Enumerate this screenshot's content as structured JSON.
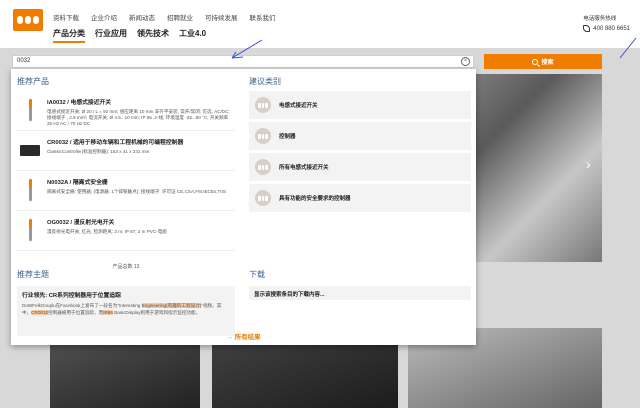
{
  "header": {
    "top_links": [
      "资料下载",
      "企业介绍",
      "新闻动态",
      "招聘就业",
      "可持续发展",
      "联系我们"
    ],
    "main_nav": [
      "产品分类",
      "行业应用",
      "领先技术",
      "工业4.0"
    ],
    "hotline_label": "电话服务热线",
    "hotline_number": "400 880 6651"
  },
  "search": {
    "query": "0032",
    "button_label": "搜索"
  },
  "panel": {
    "products_title": "推荐产品",
    "products": [
      {
        "title": "IA0032 / 电感式接近开关",
        "desc": "电感式接近开关; Ø 20 / L = 92 mm; 感应距离 10 mm 非齐平安装; 常开/常闭; 可选; AC/DC; 接线端子 , 2.5 mm²; 电流开关; Ø 4.5...10 mm; IP 65 ,2-线; 环境温度 -25...80 °C; 开关频率 25 Hz AC / 70 Hz DC",
        "thumb": "sensor"
      },
      {
        "title": "CR0032 / 适用于移动车辆和工程机械的可编程控制器",
        "desc": "ClassicController(标准控制器); 153 x 41 x 241 mm",
        "thumb": "controller"
      },
      {
        "title": "N0032A / 隔离式安全栅",
        "desc": "隔离式安全栅; 使用器; (电源器: 1个碎铁触点); 接线端子: 许可证 CE,CSA,FM,IECEx,TIIS",
        "thumb": "sensor"
      },
      {
        "title": "OG0032 / 漫反射光电开关",
        "desc": "漫反射光电开关; 红光; 检测距离: 3 m; IP 67; 2 m PVC-电缆",
        "thumb": "sensor"
      }
    ],
    "product_count": "产品总数 13",
    "suggest_title": "建议类别",
    "suggestions": [
      "电感式接近开关",
      "控制器",
      "所有电感式接近开关",
      "具有功能的安全要求的控制器"
    ],
    "topics_title": "推荐主题",
    "topic": {
      "title": "行业领先: CR系列控制器用于位置追踪",
      "desc_1": "DoWFelkGnuplu在Facebook上发布了一段名为\"Interesting ",
      "desc_hl_1": "Engineering(有趣的工程设计)",
      "desc_2": "\"视频。其中，",
      "desc_hl_2": "CR0032",
      "desc_3": "控制器被用于位置追踪，而",
      "desc_hl_3": "IR86",
      "desc_4": " BasicDisplay则用于游戏和指示监控功能。"
    },
    "downloads_title": "下载",
    "download_item": "显示该搜索条目的下载内容...",
    "all_results_label": "所有结果"
  },
  "colors": {
    "accent": "#f07d00",
    "section_title": "#3a5f8a"
  }
}
